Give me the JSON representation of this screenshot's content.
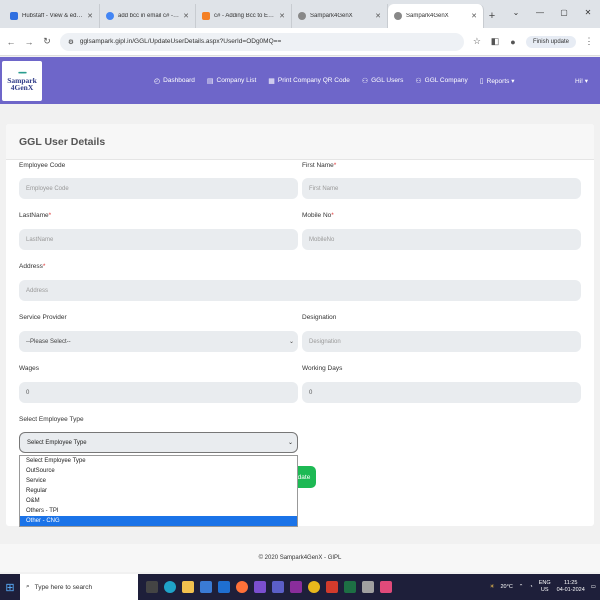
{
  "browser": {
    "tabs": [
      {
        "title": "Hubstaff - View & edit timeshe",
        "color": "#2f6fe0"
      },
      {
        "title": "add bcc in email c# - Google S",
        "color": "#4285f4"
      },
      {
        "title": "c# - Adding Bcc to Email sendi",
        "color": "#f48024"
      },
      {
        "title": "Sampark4GenX",
        "color": "#888888"
      },
      {
        "title": "Sampark4GenX",
        "color": "#888888"
      }
    ],
    "url": "gglsampark.gipl.in/GGL/UpdateUserDetails.aspx?UserId=ODg0MQ==",
    "finish_update": "Finish update"
  },
  "app": {
    "logo_line1": "Sampark",
    "logo_line2": "4GenX",
    "menu": [
      {
        "label": "Dashboard",
        "icon": "◴"
      },
      {
        "label": "Company List",
        "icon": "▤"
      },
      {
        "label": "Print Company QR Code",
        "icon": "▦"
      },
      {
        "label": "GGL Users",
        "icon": "⚇"
      },
      {
        "label": "GGL Company",
        "icon": "⚇"
      },
      {
        "label": "Reports ▾",
        "icon": "▯"
      }
    ],
    "greeting": "Hi! ▾",
    "accent": "#6e66c9"
  },
  "form": {
    "title": "GGL User Details",
    "employee_code": {
      "label": "Employee Code",
      "placeholder": "Employee Code"
    },
    "first_name": {
      "label": "First Name",
      "placeholder": "First Name"
    },
    "last_name": {
      "label": "LastName",
      "placeholder": "LastName"
    },
    "mobile": {
      "label": "Mobile No",
      "placeholder": "MobileNo"
    },
    "address": {
      "label": "Address",
      "placeholder": "Address"
    },
    "service_provider": {
      "label": "Service Provider",
      "value": "--Please Select--"
    },
    "designation": {
      "label": "Designation",
      "placeholder": "Designation"
    },
    "wages": {
      "label": "Wages",
      "value": "0"
    },
    "working_days": {
      "label": "Working Days",
      "value": "0"
    },
    "employee_type": {
      "label": "Select Employee Type",
      "value": "Select Employee Type",
      "options": [
        "Select Employee Type",
        "OutSource",
        "Service",
        "Regular",
        "O&M",
        "Others - TPI",
        "Other - CNG"
      ],
      "highlighted_index": 6
    },
    "update_label": "date",
    "required_mark": "*"
  },
  "footer": "© 2020 Sampark4GenX - GIPL",
  "taskbar": {
    "search_placeholder": "Type here to search",
    "weather": "20°C",
    "lang1": "ENG",
    "lang2": "US",
    "time": "11:25",
    "date": "04-01-2024"
  }
}
